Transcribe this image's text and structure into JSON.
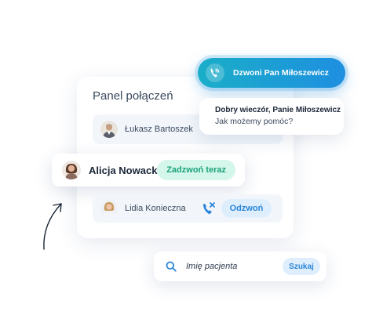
{
  "panel": {
    "title": "Panel połączeń",
    "contacts": [
      {
        "name": "Łukasz Bartoszek",
        "avatar": "avatar-man"
      },
      {
        "name": "Alicja Nowacka",
        "avatar": "avatar-woman",
        "action_label": "Zadzwoń teraz"
      },
      {
        "name": "Lidia Konieczna",
        "avatar": "avatar-woman",
        "status_icon": "missed-call-icon",
        "action_label": "Odzwoń"
      }
    ]
  },
  "incoming_call": {
    "label": "Dzwoni Pan Miłoszewicz",
    "icon": "phone-ringing-icon"
  },
  "greeting": {
    "line1": "Dobry wieczór, Panie Miłoszewicz",
    "line2": "Jak możemy pomóc?"
  },
  "search": {
    "placeholder": "Imię pacjenta",
    "icon": "search-icon",
    "button_label": "Szukaj"
  },
  "colors": {
    "accent_gradient_start": "#1aaec8",
    "accent_gradient_end": "#1e8fe0",
    "call_now_bg": "#d5f6ea",
    "call_now_text": "#1aa37a",
    "secondary_btn_bg": "#dfeefc",
    "secondary_btn_text": "#2b86d8"
  }
}
